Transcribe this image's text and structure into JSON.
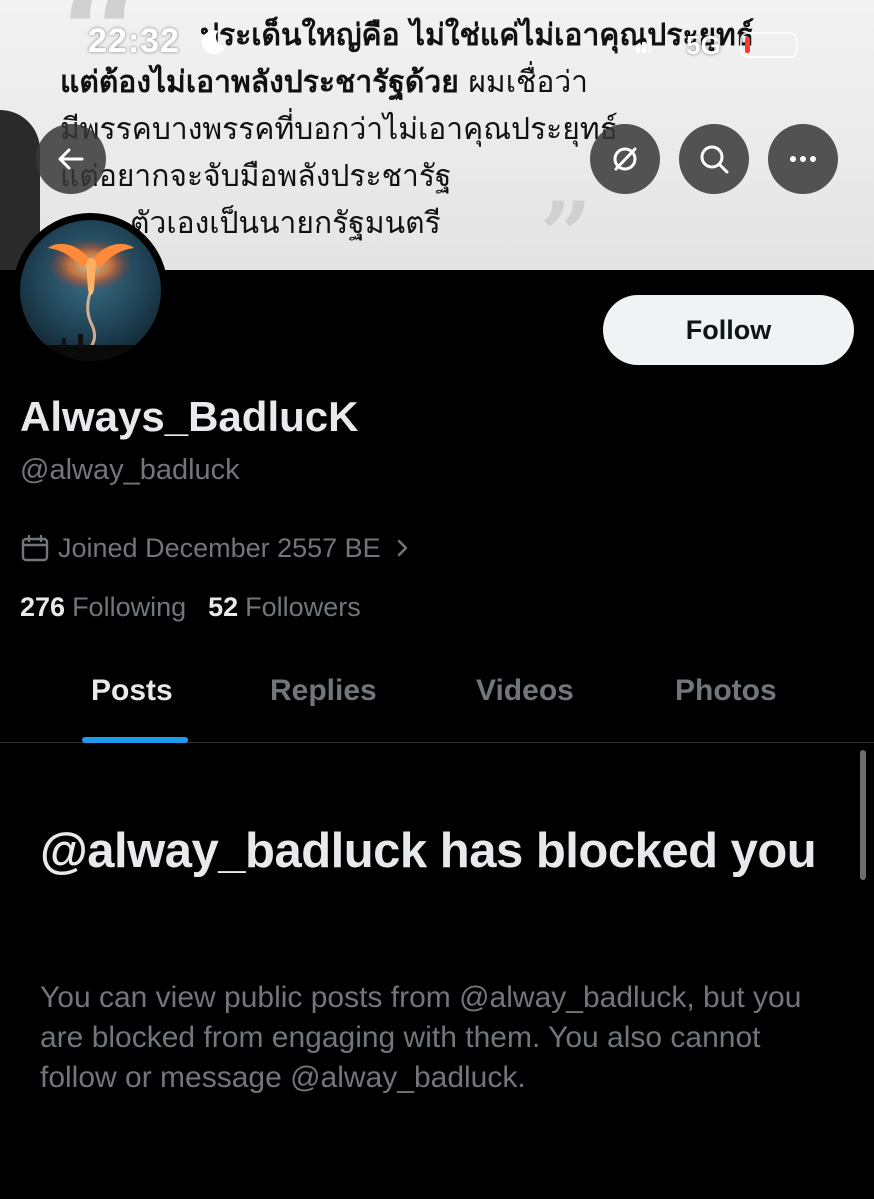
{
  "status_bar": {
    "time": "22:32",
    "network": "5G",
    "battery_color": "#ff3b30"
  },
  "banner": {
    "line1": "ประเด็นใหญ่คือ ไม่ใช่แค่ไม่เอาคุณประยุทธ์",
    "line2_bold": "แต่ต้องไม่เอาพลังประชารัฐด้วย",
    "line2_rest": " ผมเชื่อว่า",
    "line3": "มีพรรคบางพรรคที่บอกว่าไม่เอาคุณประยุทธ์",
    "line4": "แต่อยากจะจับมือพลังประชารัฐ",
    "line5": "ตัวเองเป็นนายกรัฐมนตรี"
  },
  "nav": {
    "back_icon": "arrow-left-icon",
    "grok_icon": "grok-icon",
    "search_icon": "search-icon",
    "more_icon": "more-icon"
  },
  "profile": {
    "display_name": "Always_BadlucK",
    "handle": "@alway_badluck",
    "joined": "Joined December 2557 BE",
    "following_count": "276",
    "following_label": "Following",
    "followers_count": "52",
    "followers_label": "Followers",
    "follow_button": "Follow"
  },
  "tabs": [
    {
      "label": "Posts",
      "active": true
    },
    {
      "label": "Replies",
      "active": false
    },
    {
      "label": "Videos",
      "active": false
    },
    {
      "label": "Photos",
      "active": false
    }
  ],
  "blocked": {
    "title": "@alway_badluck has blocked you",
    "description": "You can view public posts from @alway_badluck, but you are blocked from engaging with them. You also cannot follow or message @alway_badluck."
  },
  "colors": {
    "accent": "#1d9bf0",
    "muted_text": "#71767b",
    "primary_text": "#e7e9ea",
    "background": "#000000"
  }
}
